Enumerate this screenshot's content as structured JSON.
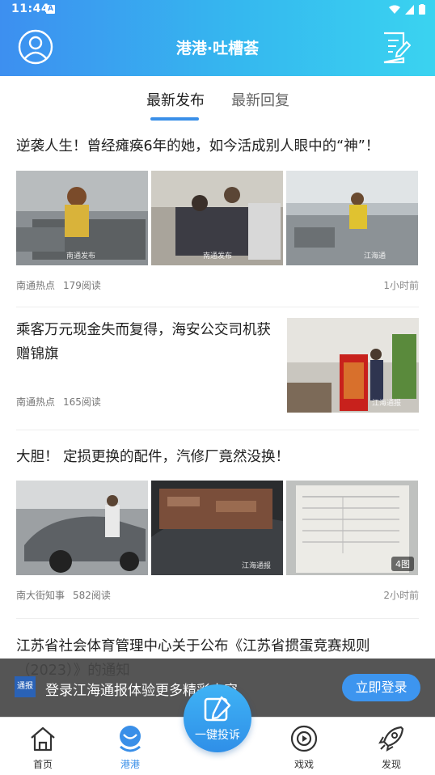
{
  "status": {
    "time": "11:44",
    "notif_glyph": "A"
  },
  "header": {
    "title": "港港·吐槽荟",
    "left_icon": "user-icon",
    "right_icon": "compose-icon"
  },
  "tabs": [
    {
      "label": "最新发布",
      "active": true
    },
    {
      "label": "最新回复",
      "active": false
    }
  ],
  "articles": [
    {
      "title": "逆袭人生！曾经瘫痪6年的她，如今活成别人眼中的“神”！",
      "source": "南通热点",
      "reads": "179阅读",
      "time": "1小时前",
      "watermarks": [
        "南通发布",
        "南通发布",
        "江海通"
      ]
    },
    {
      "title": "乘客万元现金失而复得，海安公交司机获赠锦旗",
      "source": "南通热点",
      "reads": "165阅读",
      "time": "",
      "watermarks": [
        "江海通报"
      ]
    },
    {
      "title": "大胆！ 定损更换的配件，汽修厂竟然没换！",
      "source": "南大街知事",
      "reads": "582阅读",
      "time": "2小时前",
      "watermarks": [
        "江海通报"
      ],
      "image_count": "4图"
    },
    {
      "title": "江苏省社会体育管理中心关于公布《江苏省掼蛋竞赛规则（2023）》的通知"
    }
  ],
  "login_banner": {
    "logo_text": "通报",
    "text": "登录江海通报体验更多精彩内容",
    "button": "立即登录"
  },
  "bottom_nav": [
    {
      "label": "首页",
      "icon": "home-icon"
    },
    {
      "label": "港港",
      "icon": "chat-bubble-icon",
      "active": true
    },
    {
      "label": "一键投诉",
      "icon": "edit-icon"
    },
    {
      "label": "戏戏",
      "icon": "play-icon"
    },
    {
      "label": "发现",
      "icon": "rocket-icon"
    }
  ],
  "colors": {
    "accent": "#3a8fe8",
    "header_start": "#3d8ff0",
    "header_end": "#3ad3f0"
  }
}
